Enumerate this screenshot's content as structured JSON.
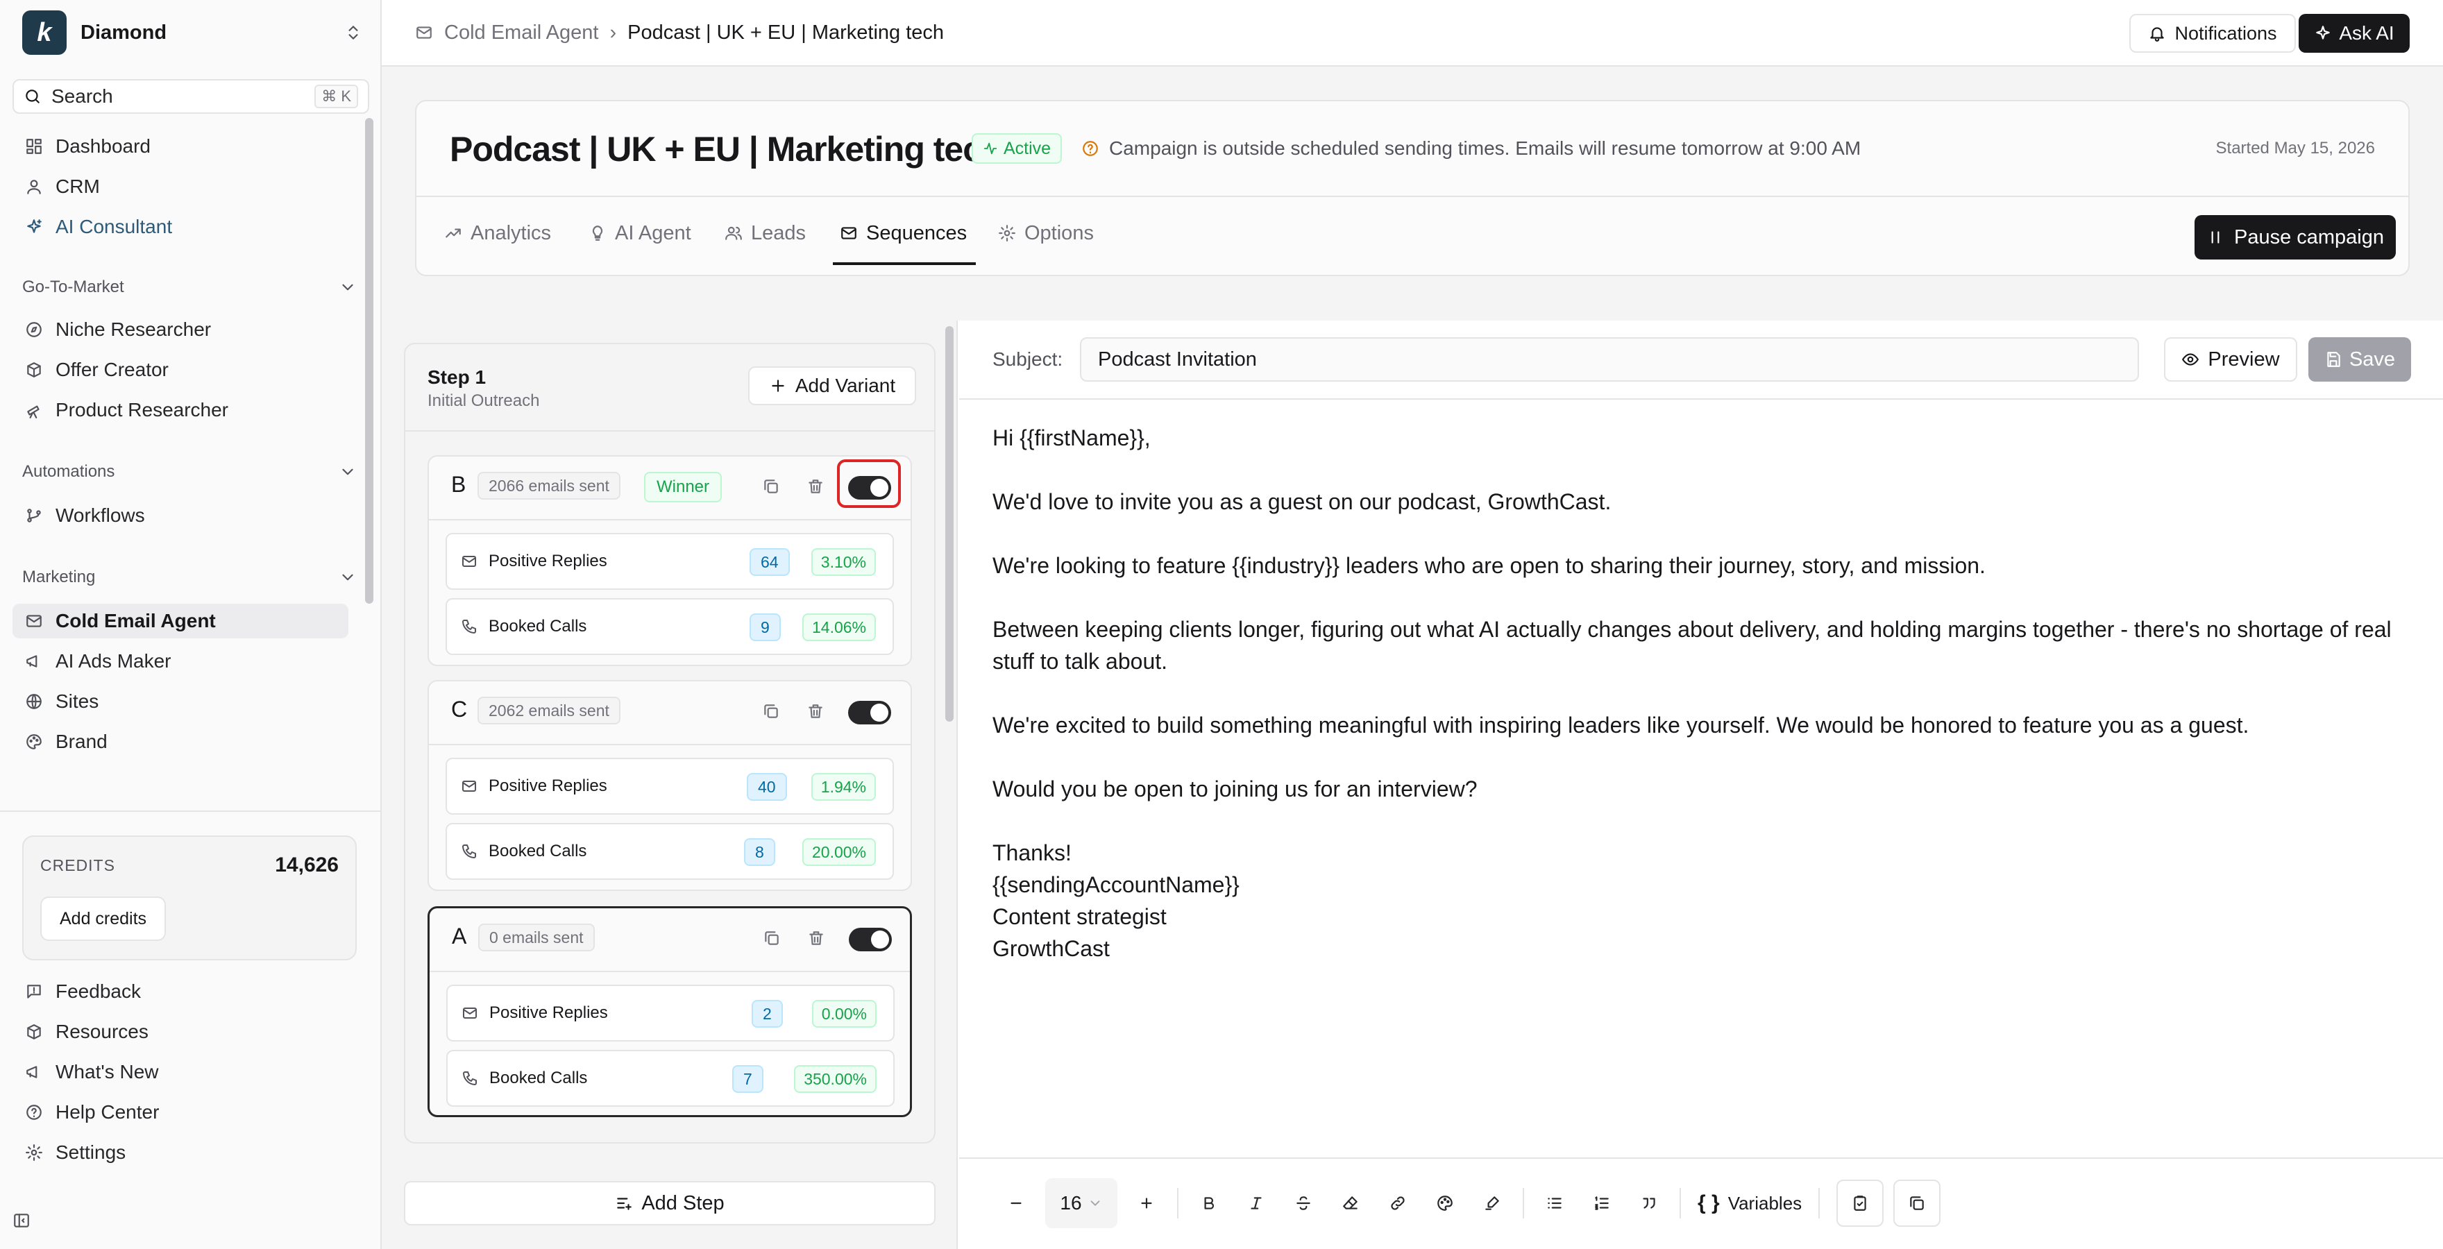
{
  "workspace": {
    "name": "Diamond",
    "logo_letter": "k"
  },
  "search": {
    "label": "Search",
    "shortcut": "⌘ K"
  },
  "nav_top": [
    {
      "label": "Dashboard",
      "icon": "dashboard-icon"
    },
    {
      "label": "CRM",
      "icon": "user-icon"
    },
    {
      "label": "AI Consultant",
      "icon": "sparkles-icon"
    }
  ],
  "sections": {
    "gtm": {
      "title": "Go-To-Market",
      "items": [
        {
          "label": "Niche Researcher",
          "icon": "compass-icon"
        },
        {
          "label": "Offer Creator",
          "icon": "package-icon"
        },
        {
          "label": "Product Researcher",
          "icon": "telescope-icon"
        }
      ]
    },
    "automations": {
      "title": "Automations",
      "items": [
        {
          "label": "Workflows",
          "icon": "git-branch-icon"
        }
      ]
    },
    "marketing": {
      "title": "Marketing",
      "items": [
        {
          "label": "Cold Email Agent",
          "icon": "mail-icon"
        },
        {
          "label": "AI Ads Maker",
          "icon": "megaphone-icon"
        },
        {
          "label": "Sites",
          "icon": "globe-icon"
        },
        {
          "label": "Brand",
          "icon": "palette-icon"
        }
      ]
    }
  },
  "credits": {
    "label": "CREDITS",
    "value": "14,626",
    "button": "Add credits"
  },
  "nav_bottom": [
    {
      "label": "Feedback",
      "icon": "feedback-icon"
    },
    {
      "label": "Resources",
      "icon": "box-icon"
    },
    {
      "label": "What's New",
      "icon": "megaphone-icon"
    },
    {
      "label": "Help Center",
      "icon": "help-icon"
    },
    {
      "label": "Settings",
      "icon": "gear-icon"
    }
  ],
  "breadcrumb": {
    "parent": "Cold Email Agent",
    "current": "Podcast | UK + EU | Marketing tech"
  },
  "topbar": {
    "notifications": "Notifications",
    "ask_ai": "Ask AI"
  },
  "campaign": {
    "title": "Podcast | UK + EU | Marketing tech",
    "status": "Active",
    "warning": "Campaign is outside scheduled sending times. Emails will resume tomorrow at 9:00 AM",
    "started": "Started May 15, 2026",
    "tabs": [
      "Analytics",
      "AI Agent",
      "Leads",
      "Sequences",
      "Options"
    ],
    "active_tab": "Sequences",
    "pause_label": "Pause campaign"
  },
  "step": {
    "title": "Step 1",
    "subtitle": "Initial Outreach",
    "add_variant": "Add Variant",
    "add_step": "Add Step"
  },
  "variants": [
    {
      "letter": "B",
      "sent": "2066 emails sent",
      "winner": "Winner",
      "enabled": true,
      "positive": {
        "label": "Positive Replies",
        "count": "64",
        "pct": "3.10%"
      },
      "booked": {
        "label": "Booked Calls",
        "count": "9",
        "pct": "14.06%"
      }
    },
    {
      "letter": "C",
      "sent": "2062 emails sent",
      "enabled": true,
      "positive": {
        "label": "Positive Replies",
        "count": "40",
        "pct": "1.94%"
      },
      "booked": {
        "label": "Booked Calls",
        "count": "8",
        "pct": "20.00%"
      }
    },
    {
      "letter": "A",
      "sent": "0 emails sent",
      "enabled": true,
      "positive": {
        "label": "Positive Replies",
        "count": "2",
        "pct": "0.00%"
      },
      "booked": {
        "label": "Booked Calls",
        "count": "7",
        "pct": "350.00%"
      }
    }
  ],
  "editor": {
    "subject_label": "Subject:",
    "subject": "Podcast Invitation",
    "preview": "Preview",
    "save": "Save",
    "body": [
      "Hi {{firstName}},",
      "We'd love to invite you as a guest on our podcast, GrowthCast.",
      "We're looking to feature {{industry}} leaders who are open to sharing their journey, story, and mission.",
      "Between keeping clients longer, figuring out what AI actually changes about delivery, and holding margins together - there's no shortage of real stuff to talk about.",
      "We're excited to build something meaningful with inspiring leaders like yourself. We would be honored to feature you as a guest.",
      "Would you be open to joining us for an interview?"
    ],
    "signature": [
      "Thanks!",
      "{{sendingAccountName}}",
      "Content strategist",
      "GrowthCast"
    ],
    "font_size": "16",
    "variables": "Variables"
  }
}
